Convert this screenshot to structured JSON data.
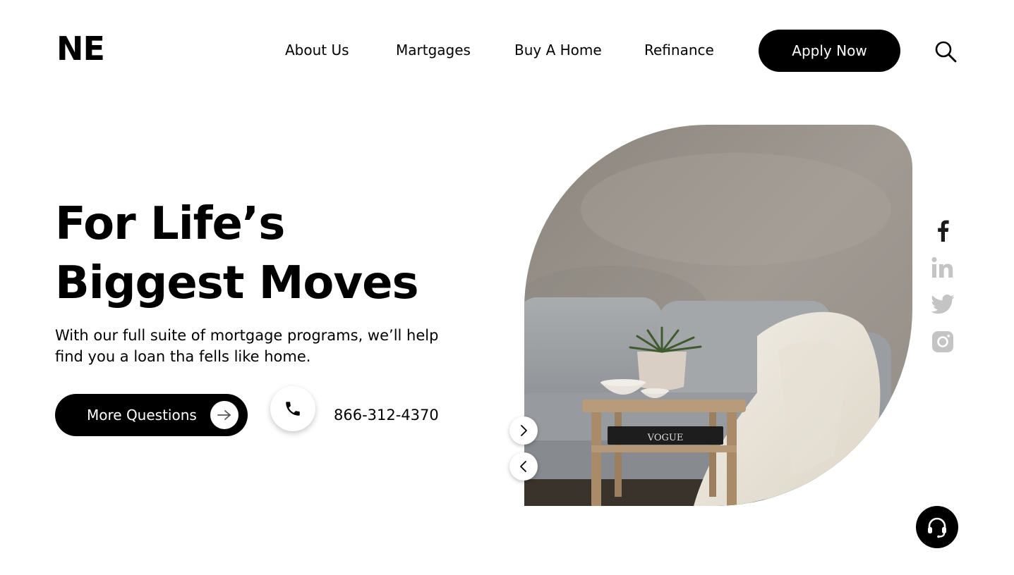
{
  "brand": {
    "logo_text": "NE"
  },
  "nav": {
    "items": [
      {
        "label": "About Us"
      },
      {
        "label": "Martgages"
      },
      {
        "label": "Buy A Home"
      },
      {
        "label": "Refinance"
      }
    ],
    "cta_label": "Apply Now",
    "search_icon": "search-icon"
  },
  "hero": {
    "title_line1": "For Life’s",
    "title_line2": "Biggest Moves",
    "subtitle": "With our full suite of mortgage programs, we’ll help find you a loan tha fells like home.",
    "more_button_label": "More Questions",
    "phone_number": "866-312-4370",
    "image_alt": "Grey sofa with blanket and wooden side table with plant",
    "book_title": "VOGUE"
  },
  "social": {
    "icons": [
      "facebook-icon",
      "linkedin-icon",
      "twitter-icon",
      "instagram-icon"
    ],
    "active_color": "#1a1a1a",
    "inactive_color": "#c4c4c4"
  },
  "colors": {
    "primary": "#000000",
    "background": "#ffffff"
  }
}
